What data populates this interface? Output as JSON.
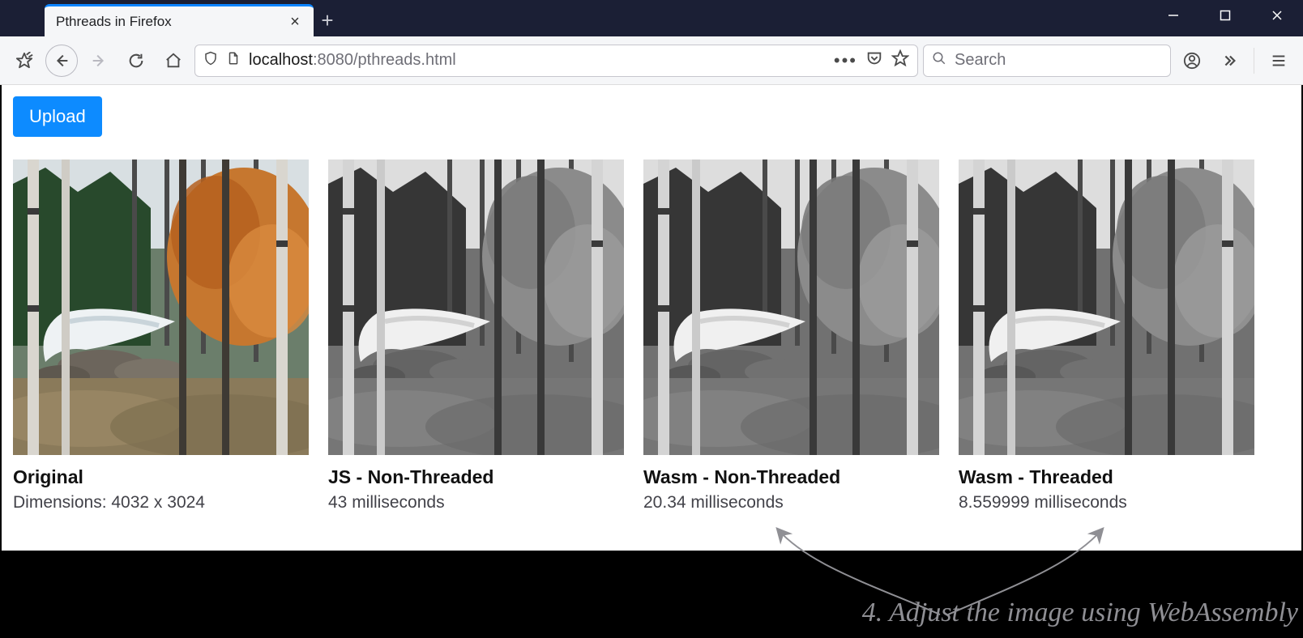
{
  "window": {
    "tab_title": "Pthreads in Firefox"
  },
  "toolbar": {
    "url_host": "localhost",
    "url_port": ":8080",
    "url_path": "/pthreads.html",
    "search_placeholder": "Search"
  },
  "page": {
    "upload_label": "Upload",
    "cards": [
      {
        "title": "Original",
        "subtitle": "Dimensions: 4032 x 3024",
        "grayscale": false
      },
      {
        "title": "JS - Non-Threaded",
        "subtitle": "43 milliseconds",
        "grayscale": true
      },
      {
        "title": "Wasm - Non-Threaded",
        "subtitle": "20.34 milliseconds",
        "grayscale": true
      },
      {
        "title": "Wasm - Threaded",
        "subtitle": "8.559999 milliseconds",
        "grayscale": true
      }
    ]
  },
  "annotation": {
    "text": "4. Adjust the image using WebAssembly"
  }
}
